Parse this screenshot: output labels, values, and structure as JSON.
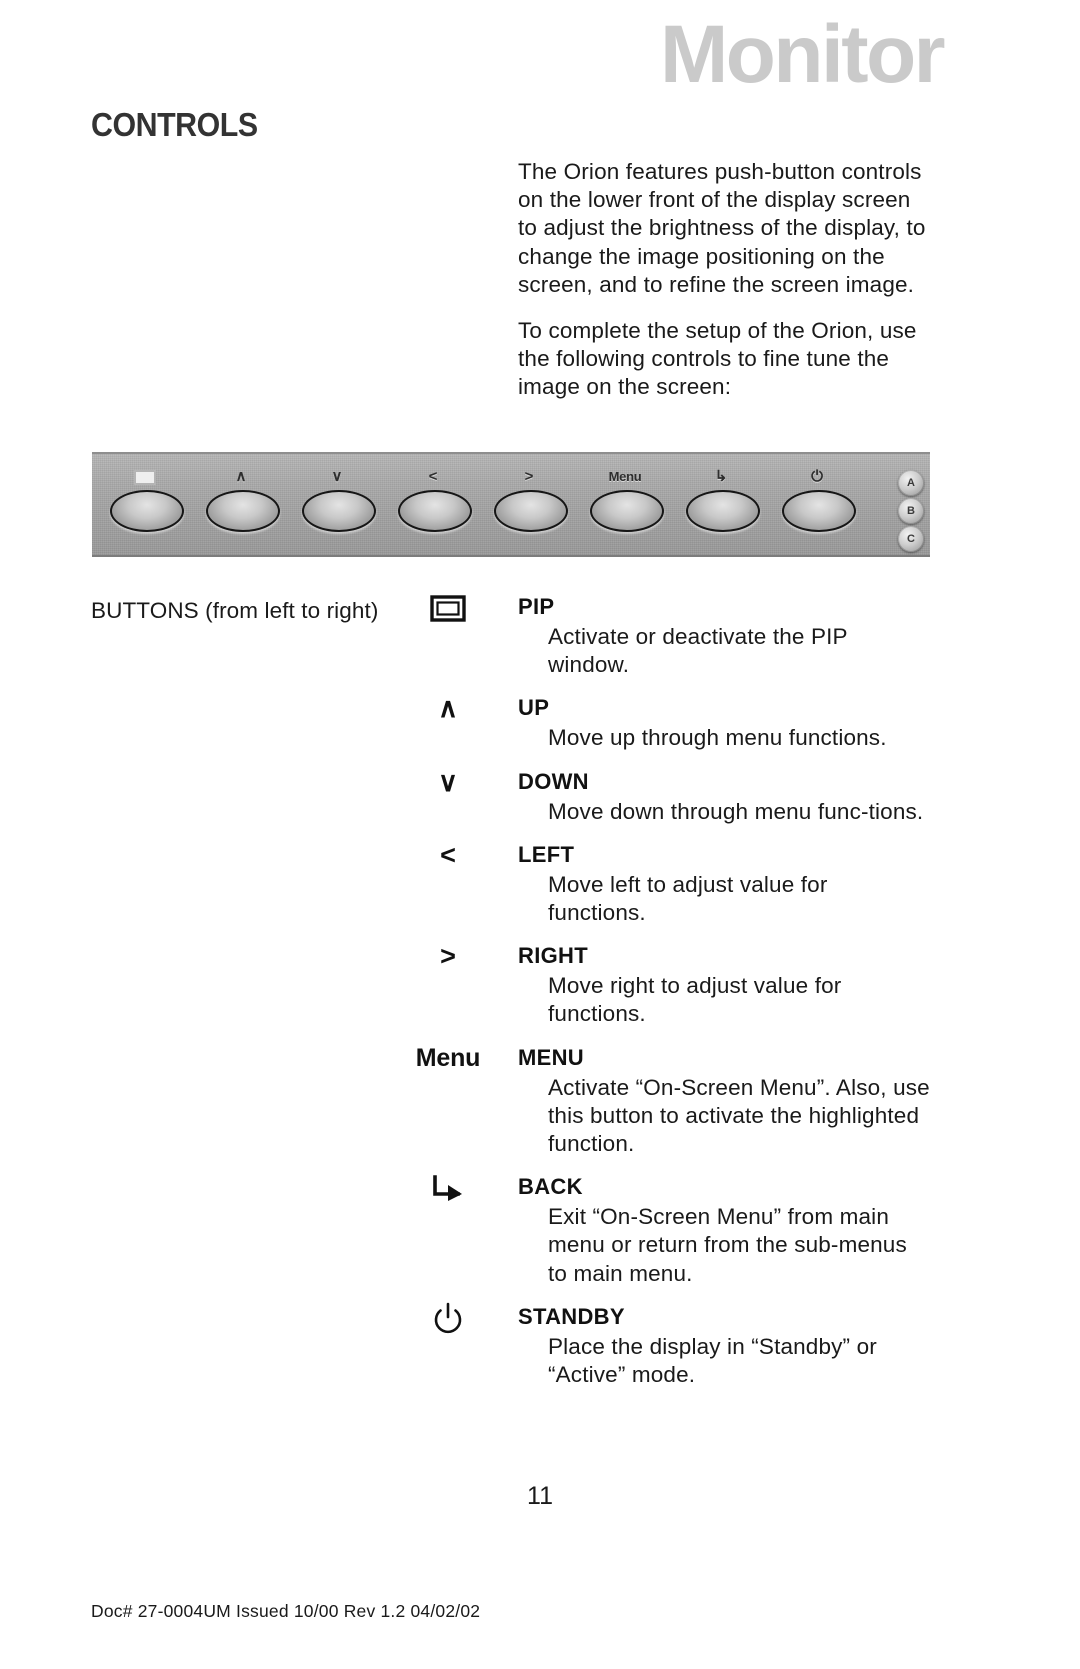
{
  "masthead": {
    "word": "Monitor",
    "color": "#cacaca"
  },
  "section": {
    "heading": "CONTROLS"
  },
  "intro": {
    "paragraph_1": "The Orion features push-button controls on the lower front of the display screen to adjust the brightness of the display, to change the image positioning on the screen, and to refine the screen image.",
    "paragraph_2": "To complete the setup of the Orion, use the following controls to fine tune the image on the screen:"
  },
  "panel_photo": {
    "caption_icons": [
      "pip-chip-icon",
      "chevron-up-icon",
      "chevron-down-icon",
      "chevron-left-icon",
      "chevron-right-icon",
      "menu-text-icon",
      "back-arrow-icon",
      "power-icon"
    ],
    "button_glyphs": [
      "",
      "∧",
      "∨",
      "<",
      ">",
      "Menu",
      "↳",
      "⏻"
    ],
    "leds": [
      "A",
      "B",
      "C"
    ]
  },
  "buttons_label": "BUTTONS (from left to right)",
  "button_entries": [
    {
      "icon_name": "pip-rectangle-icon",
      "icon_glyph": "",
      "label": "PIP",
      "description": "Activate or deactivate the PIP window."
    },
    {
      "icon_name": "chevron-up-icon",
      "icon_glyph": "∧",
      "label": "UP",
      "description": "Move up through menu functions."
    },
    {
      "icon_name": "chevron-down-icon",
      "icon_glyph": "∨",
      "label": "DOWN",
      "description": "Move down through menu func-tions."
    },
    {
      "icon_name": "chevron-left-icon",
      "icon_glyph": "<",
      "label": "LEFT",
      "description": "Move left to adjust value for functions."
    },
    {
      "icon_name": "chevron-right-icon",
      "icon_glyph": ">",
      "label": "RIGHT",
      "description": "Move right to adjust value for functions."
    },
    {
      "icon_name": "menu-text-icon",
      "icon_glyph": "Menu",
      "label": "MENU",
      "description": "Activate “On-Screen Menu”.  Also, use this button to activate the highlighted function."
    },
    {
      "icon_name": "back-arrow-icon",
      "icon_glyph": "↳",
      "label": "BACK",
      "description": "Exit “On-Screen Menu” from main menu or return from the sub-menus to main menu."
    },
    {
      "icon_name": "power-standby-icon",
      "icon_glyph": "⏻",
      "label": "STANDBY",
      "description": "Place the display in “Standby” or “Active” mode."
    }
  ],
  "page_number": "11",
  "footer": "Doc# 27-0004UM  Issued 10/00  Rev 1.2 04/02/02"
}
